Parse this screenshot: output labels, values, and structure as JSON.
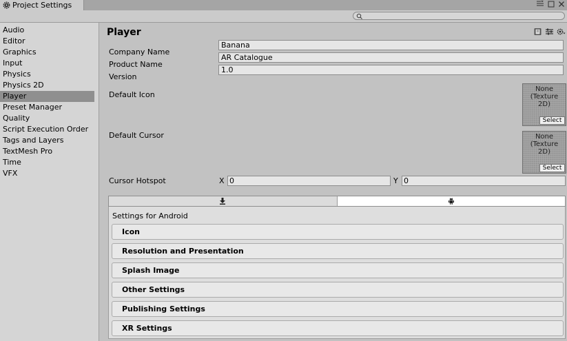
{
  "window": {
    "tab_title": "Project Settings",
    "tab_icon": "gear-icon",
    "controls": [
      "menu-icon",
      "maximize-icon",
      "close-icon"
    ]
  },
  "search": {
    "value": "",
    "icon": "search-icon"
  },
  "sidebar": {
    "selected": "Player",
    "items": [
      {
        "label": "Audio"
      },
      {
        "label": "Editor"
      },
      {
        "label": "Graphics"
      },
      {
        "label": "Input"
      },
      {
        "label": "Physics"
      },
      {
        "label": "Physics 2D"
      },
      {
        "label": "Player"
      },
      {
        "label": "Preset Manager"
      },
      {
        "label": "Quality"
      },
      {
        "label": "Script Execution Order"
      },
      {
        "label": "Tags and Layers"
      },
      {
        "label": "TextMesh Pro"
      },
      {
        "label": "Time"
      },
      {
        "label": "VFX"
      }
    ]
  },
  "player": {
    "title": "Player",
    "header_icons": [
      "help-book-icon",
      "presets-icon",
      "settings-menu-icon"
    ],
    "company_name": {
      "label": "Company Name",
      "value": "Banana"
    },
    "product_name": {
      "label": "Product Name",
      "value": "AR Catalogue"
    },
    "version": {
      "label": "Version",
      "value": "1.0"
    },
    "default_icon": {
      "label": "Default Icon",
      "none_text": "None\n(Texture\n2D)",
      "select_label": "Select"
    },
    "default_cursor": {
      "label": "Default Cursor",
      "none_text": "None\n(Texture\n2D)",
      "select_label": "Select"
    },
    "cursor_hotspot": {
      "label": "Cursor Hotspot",
      "x_label": "X",
      "x_value": "0",
      "y_label": "Y",
      "y_value": "0"
    },
    "platform_tabs": [
      {
        "icon": "standalone-download-icon",
        "selected": false
      },
      {
        "icon": "android-icon",
        "selected": true
      }
    ],
    "settings_for": "Settings for Android",
    "sections": [
      {
        "label": "Icon"
      },
      {
        "label": "Resolution and Presentation"
      },
      {
        "label": "Splash Image"
      },
      {
        "label": "Other Settings"
      },
      {
        "label": "Publishing Settings"
      },
      {
        "label": "XR Settings"
      }
    ]
  }
}
